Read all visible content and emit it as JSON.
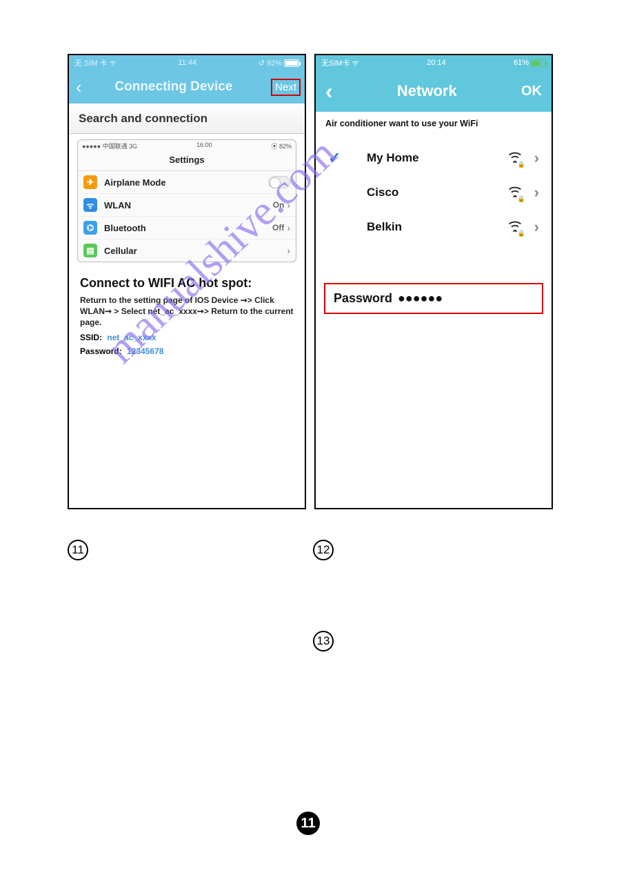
{
  "page_number": "11",
  "watermark": "manualshive.com",
  "labels": {
    "l11": "11",
    "l12": "12",
    "l13": "13"
  },
  "phone1": {
    "status": {
      "left": "无 SIM 卡 ᯤ",
      "time": "11:44",
      "right": "↺ 92%"
    },
    "nav": {
      "title": "Connecting Device",
      "next": "Next"
    },
    "search_title": "Search and connection",
    "inner": {
      "status_left": "●●●●● 中国联通 3G",
      "status_time": "16:00",
      "status_right": "⦿ 82%",
      "title": "Settings",
      "rows": [
        {
          "label": "Airplane Mode",
          "value": "",
          "has_switch": true
        },
        {
          "label": "WLAN",
          "value": "On"
        },
        {
          "label": "Bluetooth",
          "value": "Off"
        },
        {
          "label": "Cellular",
          "value": ""
        }
      ]
    },
    "hotspot_heading": "Connect to WIFI AC hot spot:",
    "hotspot_text": "Return to the setting page of IOS Device ➞> Click WLAN➞ > Select net_ac_xxxx➞> Return to the current page.",
    "ssid_label": "SSID:",
    "ssid_value": "net_ac_xxxx",
    "pw_label": "Password:",
    "pw_value": "12345678"
  },
  "phone2": {
    "status": {
      "left": "无SIM卡 ᯤ",
      "time": "20:14",
      "right": "61%"
    },
    "nav": {
      "title": "Network",
      "ok": "OK"
    },
    "subtitle": "Air conditioner want to use your WiFi",
    "networks": [
      {
        "name": "My Home",
        "selected": true
      },
      {
        "name": "Cisco",
        "selected": false
      },
      {
        "name": "Belkin",
        "selected": false
      }
    ],
    "password_label": "Password",
    "password_dots": "●●●●●●"
  }
}
